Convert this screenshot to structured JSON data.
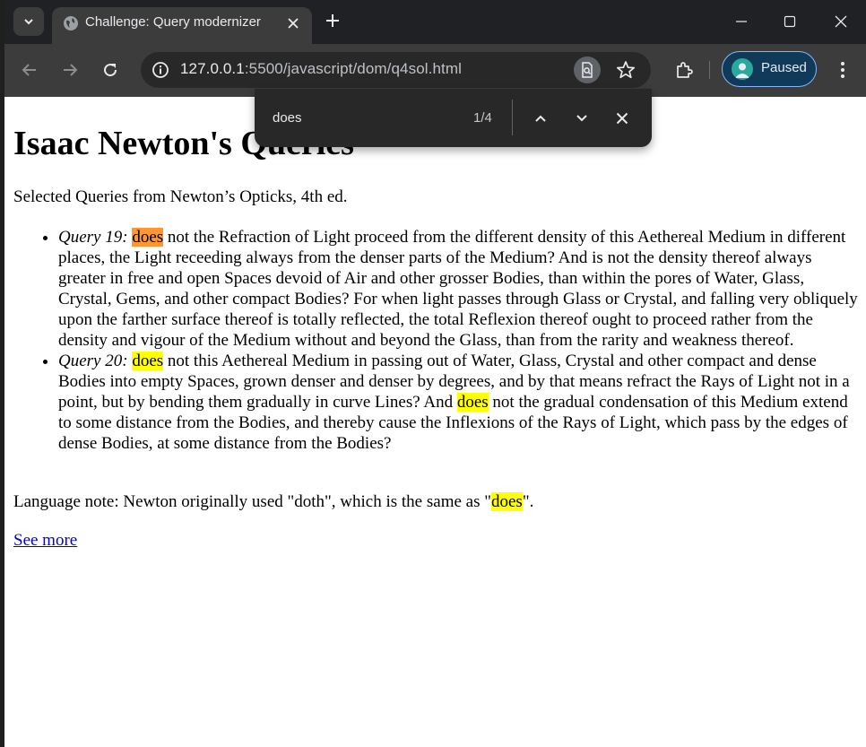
{
  "browser": {
    "tab": {
      "title": "Challenge: Query modernizer"
    },
    "url": {
      "host": "127.0.0.1",
      "rest": ":5500/javascript/dom/q4sol.html"
    },
    "profile": {
      "label": "Paused"
    }
  },
  "findbar": {
    "query": "does",
    "count": "1/4"
  },
  "page": {
    "title": "Isaac Newton's Queries",
    "subtitle": "Selected Queries from Newton’s Opticks, 4th ed.",
    "queries": [
      {
        "label": "Query 19:",
        "match": "does",
        "text": " not the Refraction of Light proceed from the different density of this Aethereal Medium in different places, the Light receeding always from the denser parts of the Medium? And is not the density thereof always greater in free and open Spaces devoid of Air and other grosser Bodies, than within the pores of Water, Glass, Crystal, Gems, and other compact Bodies? For when light passes through Glass or Crystal, and falling very obliquely upon the farther surface thereof is totally reflected, the total Reflexion thereof ought to proceed rather from the density and vigour of the Medium without and beyond the Glass, than from the rarity and weakness thereof."
      },
      {
        "label": "Query 20:",
        "match": "does",
        "text_a": " not this Aethereal Medium in passing out of Water, Glass, Crystal and other compact and dense Bodies into empty Spaces, grown denser and denser by degrees, and by that means refract the Rays of Light not in a point, but by bending them gradually in curve Lines? And ",
        "match_b": "does",
        "text_b": " not the gradual condensation of this Medium extend to some distance from the Bodies, and thereby cause the Inflexions of the Rays of Light, which pass by the edges of dense Bodies, at some distance from the Bodies?"
      }
    ],
    "note": {
      "prefix": "Language note: Newton originally used \"doth\", which is the same as \"",
      "match": "does",
      "suffix": "\"."
    },
    "link": "See more"
  },
  "colors": {
    "highlight": "#ffff00",
    "highlight_active": "#ff9632",
    "link": "#0000ee",
    "chrome_dark": "#202124",
    "toolbar": "#3c3c3c"
  },
  "icons": [
    "tab-search-icon",
    "globe-icon",
    "close-icon",
    "plus-icon",
    "minimize-icon",
    "maximize-icon",
    "back-icon",
    "forward-icon",
    "reload-icon",
    "site-info-icon",
    "find-icon",
    "star-icon",
    "extensions-icon",
    "avatar-icon",
    "kebab-menu-icon",
    "chevron-up-icon",
    "chevron-down-icon"
  ]
}
